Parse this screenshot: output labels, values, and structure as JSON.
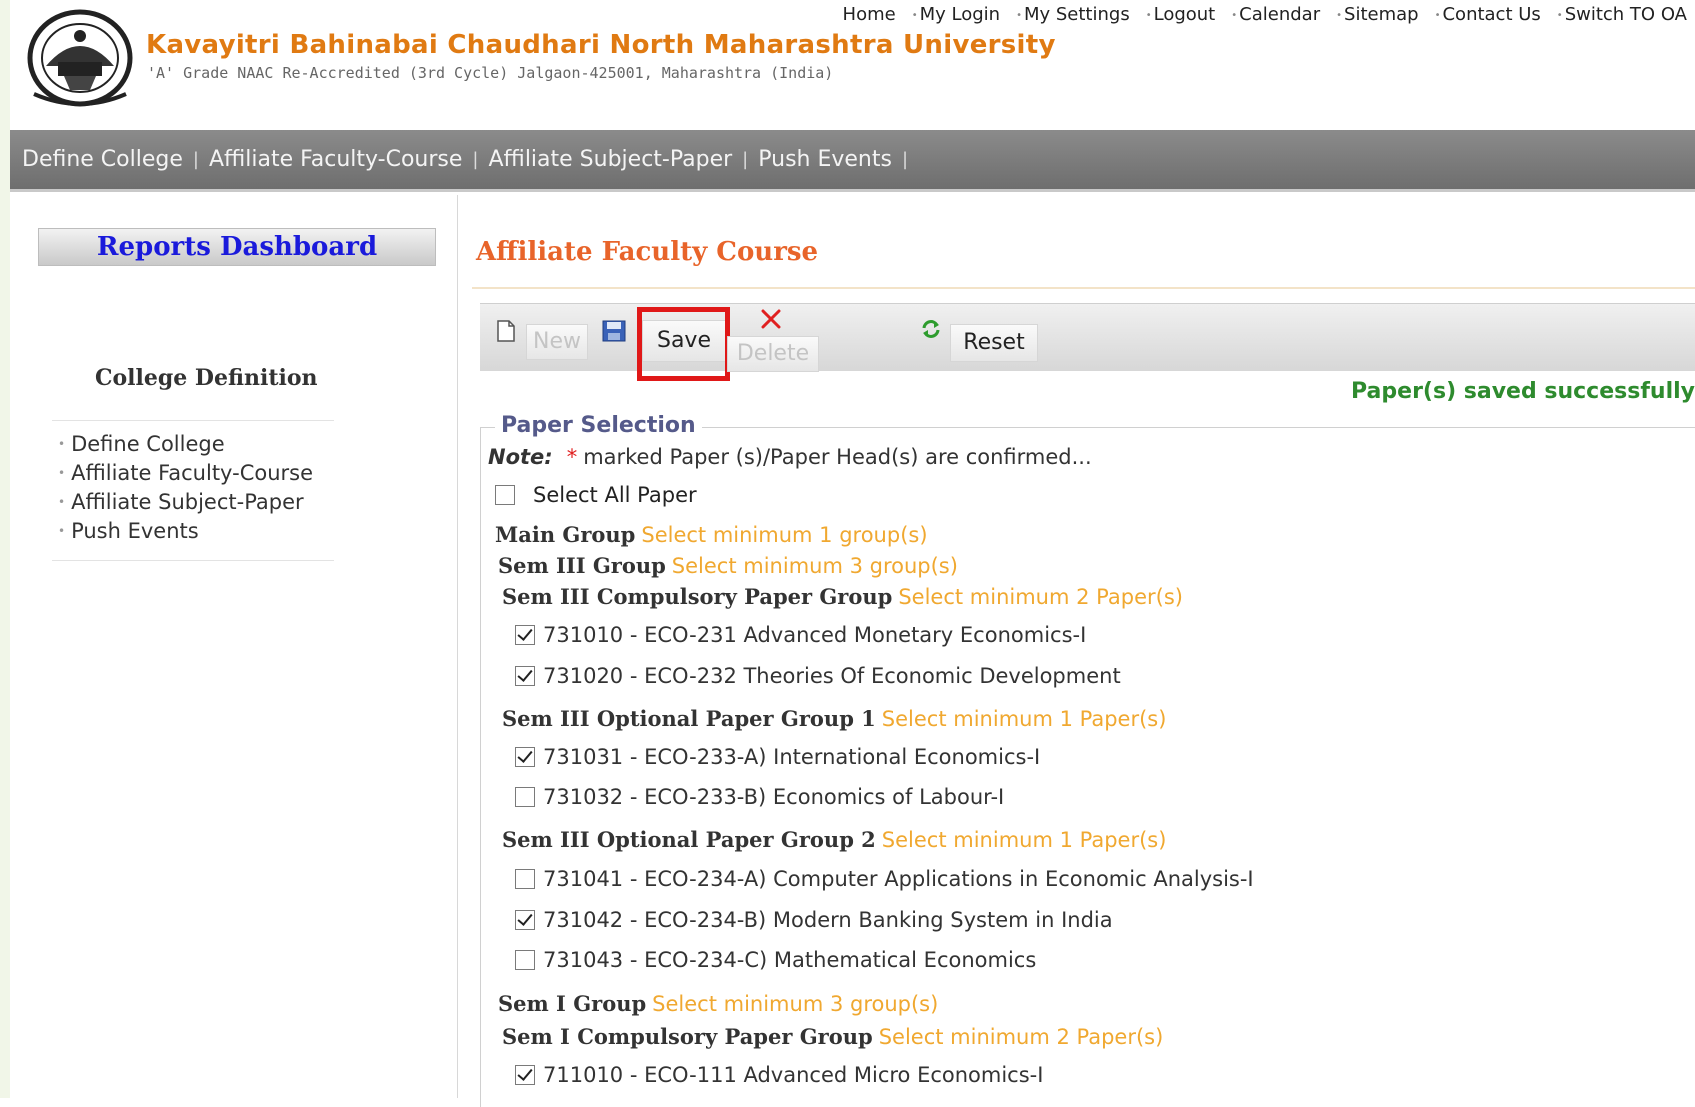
{
  "header": {
    "university_name": "Kavayitri Bahinabai Chaudhari North Maharashtra University",
    "subtitle": "'A' Grade NAAC Re-Accredited (3rd Cycle) Jalgaon-425001, Maharashtra (India)",
    "links": [
      "Home",
      "My Login",
      "My Settings",
      "Logout",
      "Calendar",
      "Sitemap",
      "Contact Us",
      "Switch TO OA"
    ]
  },
  "navbar": {
    "items": [
      "Define College",
      "Affiliate Faculty-Course",
      "Affiliate Subject-Paper",
      "Push Events"
    ]
  },
  "sidebar": {
    "dashboard_label": "Reports Dashboard",
    "section_title": "College Definition",
    "items": [
      "Define College",
      "Affiliate Faculty-Course",
      "Affiliate Subject-Paper",
      "Push Events"
    ]
  },
  "main": {
    "title": "Affiliate Faculty Course",
    "toolbar": {
      "new_label": "New",
      "save_label": "Save",
      "delete_label": "Delete",
      "reset_label": "Reset"
    },
    "status_message": "Paper(s) saved successfully",
    "legend": "Paper Selection",
    "note_label": "Note:",
    "note_star": "*",
    "note_text": "marked Paper (s)/Paper Head(s) are confirmed...",
    "select_all_label": "Select All Paper",
    "groups": [
      {
        "name": "Main Group",
        "requirement": "Select minimum 1 group(s)"
      },
      {
        "name": "Sem III Group",
        "requirement": "Select minimum 3 group(s)"
      },
      {
        "name": "Sem III Compulsory Paper Group",
        "requirement": "Select minimum 2 Paper(s)"
      },
      {
        "name": "Sem III Optional Paper Group 1",
        "requirement": "Select minimum 1 Paper(s)"
      },
      {
        "name": "Sem III Optional Paper Group 2",
        "requirement": "Select minimum 1 Paper(s)"
      },
      {
        "name": "Sem I Group",
        "requirement": "Select minimum 3 group(s)"
      },
      {
        "name": "Sem I Compulsory Paper Group",
        "requirement": "Select minimum 2 Paper(s)"
      }
    ],
    "papers": [
      {
        "label": "731010 - ECO-231 Advanced Monetary Economics-I",
        "checked": true
      },
      {
        "label": "731020 - ECO-232 Theories Of Economic Development",
        "checked": true
      },
      {
        "label": "731031 - ECO-233-A) International Economics-I",
        "checked": true
      },
      {
        "label": "731032 - ECO-233-B) Economics of Labour-I",
        "checked": false
      },
      {
        "label": "731041 - ECO-234-A) Computer Applications in Economic Analysis-I",
        "checked": false
      },
      {
        "label": "731042 - ECO-234-B) Modern Banking System in India",
        "checked": true
      },
      {
        "label": "731043 - ECO-234-C) Mathematical Economics",
        "checked": false
      },
      {
        "label": "711010 - ECO-111 Advanced Micro Economics-I",
        "checked": true
      }
    ]
  },
  "colors": {
    "university_name": "#e07a12",
    "page_title": "#e8642a",
    "requirement_text": "#f0a830",
    "success": "#2e8b2e",
    "dashboard_text": "#1a1adb",
    "highlight_border": "#e01818"
  }
}
